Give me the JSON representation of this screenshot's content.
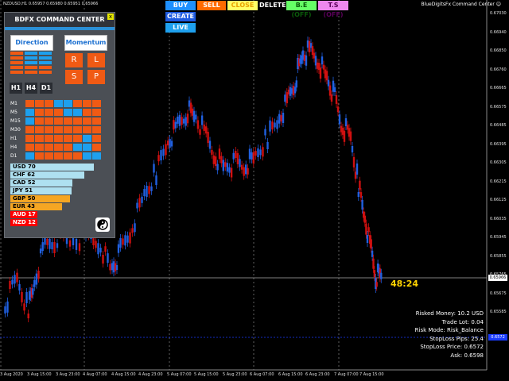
{
  "window": {
    "symbol_info": "NZDUSD,H1  0.65957 0.65980 0.65951 0.65966",
    "ea_name": "BlueDigitsFx Command Center ☺"
  },
  "trade_buttons": [
    {
      "name": "buy-button",
      "label": "BUY",
      "bg": "#1e90ff",
      "fg": "#ffffff"
    },
    {
      "name": "sell-button",
      "label": "SELL",
      "bg": "#ff6a00",
      "fg": "#ffffff"
    },
    {
      "name": "close-button",
      "label": "CLOSE",
      "bg": "#ffff66",
      "fg": "#e8a000"
    },
    {
      "name": "delete-button",
      "label": "DELETE",
      "bg": "#000000",
      "fg": "#ffffff"
    },
    {
      "name": "breakeven-button",
      "label": "B.E (OFF)",
      "bg": "#66ff66",
      "fg": "#0a5a0a"
    },
    {
      "name": "trailing-stop-button",
      "label": "T.S (OFF)",
      "bg": "#ee88ee",
      "fg": "#5a005a"
    },
    {
      "name": "create-button",
      "label": "CREATE",
      "bg": "#1e5ae0",
      "fg": "#ffffff"
    },
    {
      "name": "live-button",
      "label": "LIVE",
      "bg": "#1ea0ee",
      "fg": "#ffffff"
    }
  ],
  "panel": {
    "title": "BDFX COMMAND CENTER",
    "close_label": "x",
    "direction_label": "Direction",
    "momentum_label": "Momentum",
    "momentum_buttons": [
      "R",
      "L",
      "S",
      "P"
    ],
    "timeframe_buttons": [
      "H1",
      "H4",
      "D1"
    ],
    "grid_rows": [
      {
        "label": "M1",
        "cells": [
          "o",
          "o",
          "o",
          "b",
          "b",
          "o",
          "o",
          "o"
        ]
      },
      {
        "label": "M5",
        "cells": [
          "b",
          "o",
          "o",
          "o",
          "b",
          "b",
          "o",
          "o"
        ]
      },
      {
        "label": "M15",
        "cells": [
          "b",
          "o",
          "o",
          "o",
          "o",
          "o",
          "o",
          "o"
        ]
      },
      {
        "label": "M30",
        "cells": [
          "o",
          "o",
          "o",
          "o",
          "o",
          "o",
          "o",
          "o"
        ]
      },
      {
        "label": "H1",
        "cells": [
          "o",
          "o",
          "o",
          "o",
          "o",
          "o",
          "b",
          "o"
        ]
      },
      {
        "label": "H4",
        "cells": [
          "o",
          "o",
          "o",
          "o",
          "o",
          "b",
          "b",
          "o"
        ]
      },
      {
        "label": "D1",
        "cells": [
          "b",
          "o",
          "o",
          "o",
          "o",
          "o",
          "b",
          "b"
        ]
      }
    ],
    "currency_strength": [
      {
        "label": "USD  70",
        "value": 70,
        "color": "#aee0f0"
      },
      {
        "label": "CHF  62",
        "value": 62,
        "color": "#aee0f0"
      },
      {
        "label": "CAD  52",
        "value": 52,
        "color": "#aee0f0"
      },
      {
        "label": "JPY  51",
        "value": 51,
        "color": "#aee0f0"
      },
      {
        "label": "GBP  50",
        "value": 50,
        "color": "#f5a623"
      },
      {
        "label": "EUR  43",
        "value": 43,
        "color": "#f5a623"
      },
      {
        "label": "AUD  17",
        "value": 17,
        "color": "#ff0000"
      },
      {
        "label": "NZD  12",
        "value": 12,
        "color": "#ff0000"
      }
    ]
  },
  "price_axis": [
    "0.67030",
    "0.66940",
    "0.66850",
    "0.66760",
    "0.66665",
    "0.66575",
    "0.66485",
    "0.66395",
    "0.66305",
    "0.66215",
    "0.66125",
    "0.66035",
    "0.65945",
    "0.65855",
    "0.65765",
    "0.65675",
    "0.65585"
  ],
  "current_price": "0.65966",
  "stoploss_price_tag": "0.6572",
  "time_axis": [
    "3 Aug 2020",
    "3 Aug 15:00",
    "3 Aug 23:00",
    "4 Aug 07:00",
    "4 Aug 15:00",
    "4 Aug 23:00",
    "5 Aug 07:00",
    "5 Aug 15:00",
    "5 Aug 23:00",
    "6 Aug 07:00",
    "6 Aug 15:00",
    "6 Aug 23:00",
    "7 Aug 07:00",
    "7 Aug 15:00"
  ],
  "countdown": "48:24",
  "info_lines": [
    "Risked Money: 10.2 USD",
    "Trade Lot: 0.04",
    "Risk Mode: Risk_Balance",
    "StopLoss Pips: 25.4",
    "StopLoss Price: 0.6572",
    "Ask: 0.6598"
  ],
  "colors": {
    "bull": "#2060e0",
    "bear": "#d01010",
    "orange_cell": "#f05a14",
    "blue_cell": "#1ea0ee"
  }
}
